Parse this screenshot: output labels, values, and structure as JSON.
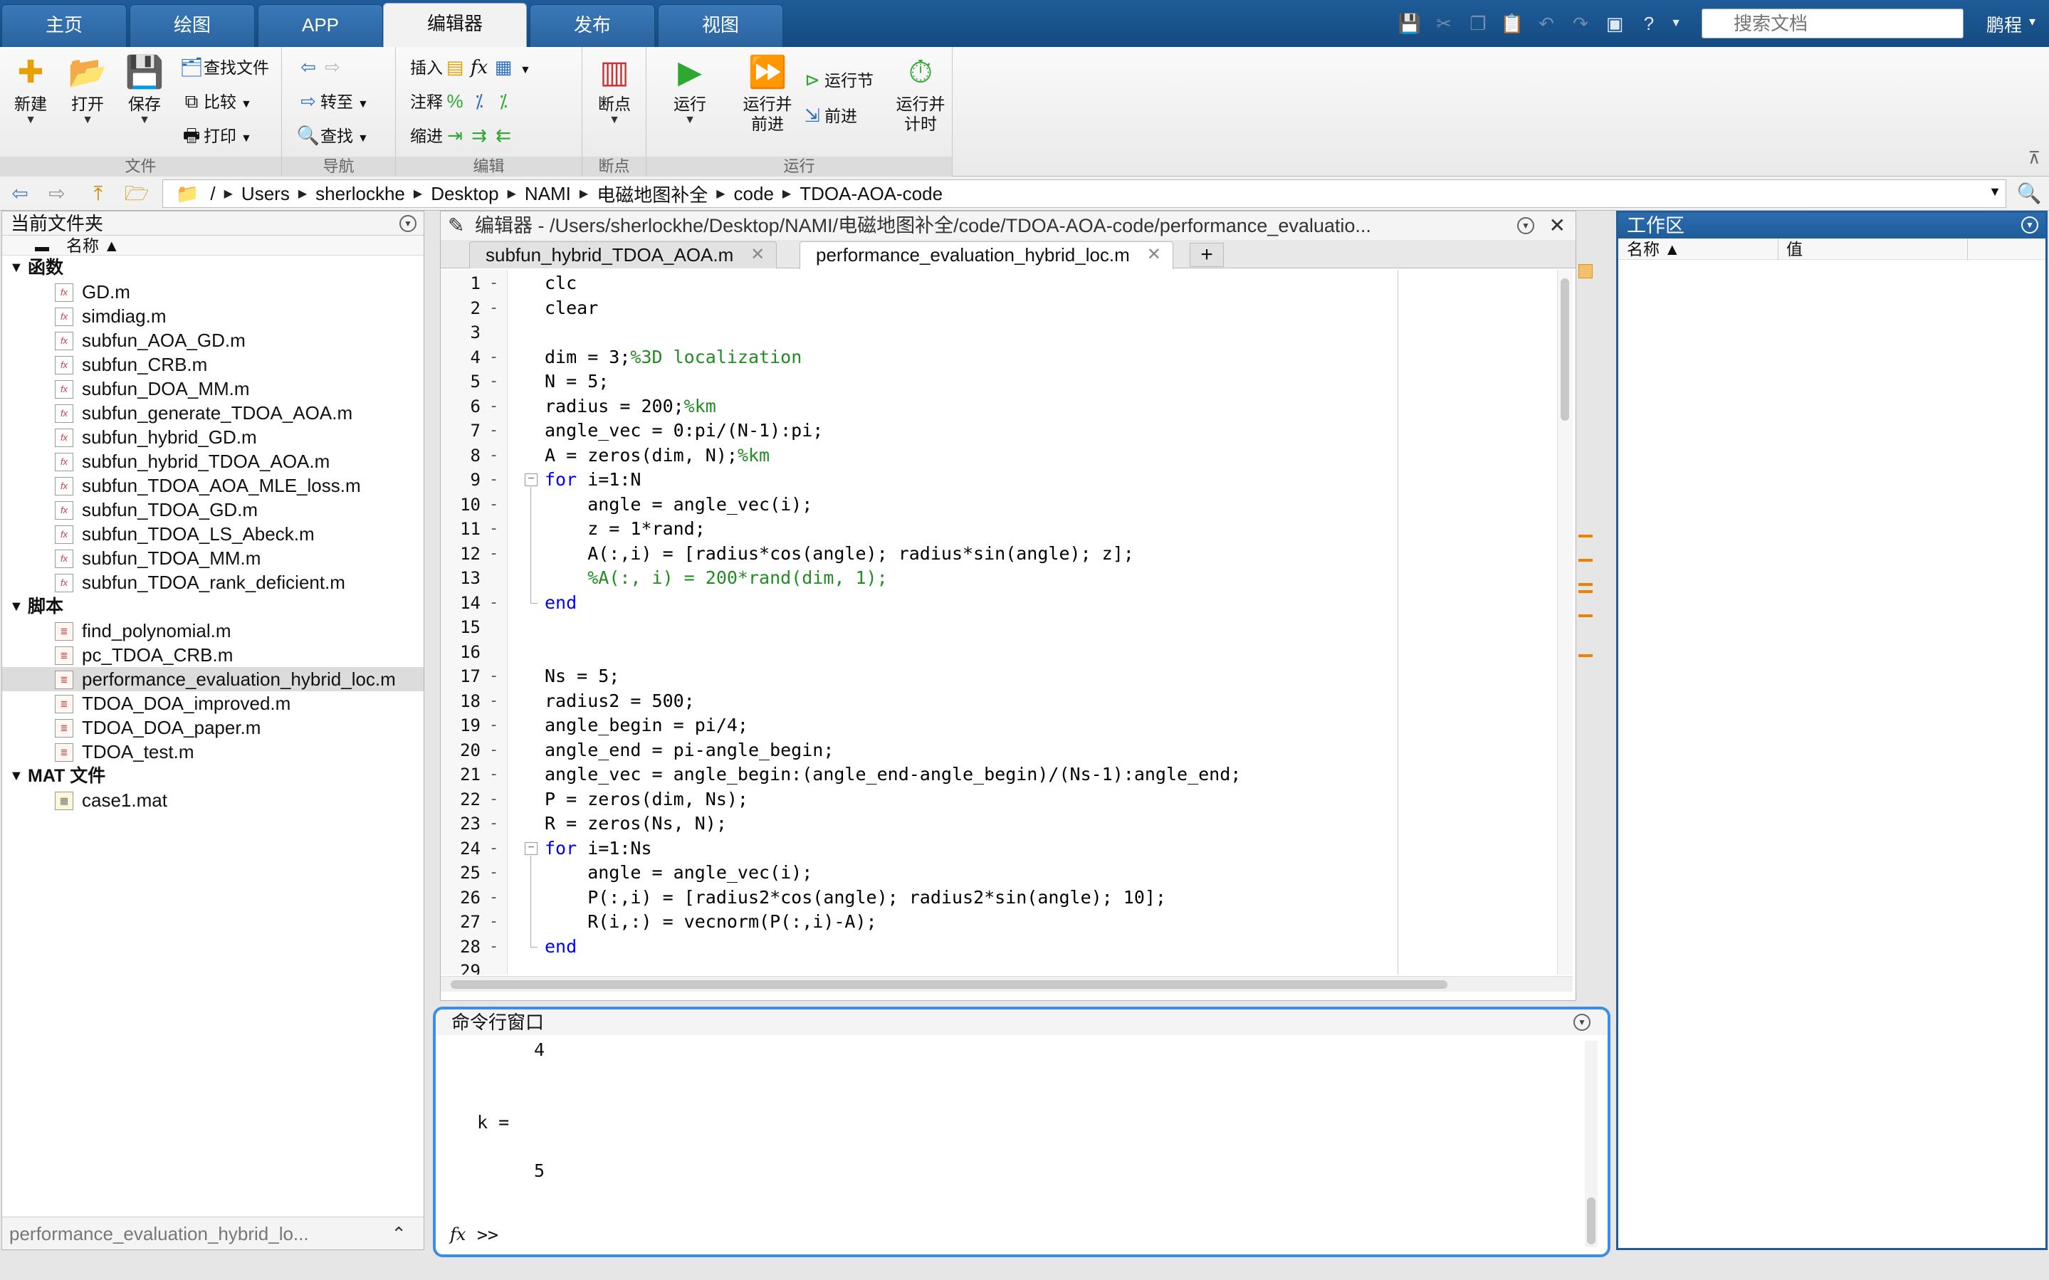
{
  "top_tabs": [
    {
      "label": "主页"
    },
    {
      "label": "绘图"
    },
    {
      "label": "APP"
    },
    {
      "label": "编辑器"
    },
    {
      "label": "发布"
    },
    {
      "label": "视图"
    }
  ],
  "search": {
    "placeholder": "搜索文档"
  },
  "user": {
    "name": "鹏程"
  },
  "ribbon": {
    "groups": {
      "file": "文件",
      "nav": "导航",
      "edit": "编辑",
      "breakpoints": "断点",
      "run": "运行"
    },
    "new": "新建",
    "open": "打开",
    "save": "保存",
    "find_files": "查找文件",
    "compare": "比较",
    "print": "打印",
    "goto": "转至",
    "find": "查找",
    "insert": "插入",
    "comment": "注释",
    "indent": "缩进",
    "breakpoint": "断点",
    "run_btn": "运行",
    "run_advance": "运行并\n前进",
    "run_section": "运行节",
    "advance": "前进",
    "run_time": "运行并\n计时",
    "fx": "fx",
    "percent": "%"
  },
  "path": [
    "Users",
    "sherlockhe",
    "Desktop",
    "NAMI",
    "电磁地图补全",
    "code",
    "TDOA-AOA-code"
  ],
  "path_root": "/",
  "folder": {
    "title": "当前文件夹",
    "col_name": "名称 ▲",
    "sections": [
      {
        "name": "函数",
        "files": [
          "GD.m",
          "simdiag.m",
          "subfun_AOA_GD.m",
          "subfun_CRB.m",
          "subfun_DOA_MM.m",
          "subfun_generate_TDOA_AOA.m",
          "subfun_hybrid_GD.m",
          "subfun_hybrid_TDOA_AOA.m",
          "subfun_TDOA_AOA_MLE_loss.m",
          "subfun_TDOA_GD.m",
          "subfun_TDOA_LS_Abeck.m",
          "subfun_TDOA_MM.m",
          "subfun_TDOA_rank_deficient.m"
        ]
      },
      {
        "name": "脚本",
        "files": [
          "find_polynomial.m",
          "pc_TDOA_CRB.m",
          "performance_evaluation_hybrid_loc.m",
          "TDOA_DOA_improved.m",
          "TDOA_DOA_paper.m",
          "TDOA_test.m"
        ]
      },
      {
        "name": "MAT 文件",
        "files": [
          "case1.mat"
        ]
      }
    ],
    "footer": "performance_evaluation_hybrid_lo..."
  },
  "editor": {
    "title": "编辑器 - /Users/sherlockhe/Desktop/NAMI/电磁地图补全/code/TDOA-AOA-code/performance_evaluatio...",
    "tabs": [
      {
        "label": "subfun_hybrid_TDOA_AOA.m"
      },
      {
        "label": "performance_evaluation_hybrid_loc.m"
      }
    ],
    "new_tab": "+",
    "lines": [
      {
        "n": "1",
        "t": "clc"
      },
      {
        "n": "2",
        "t": "clear"
      },
      {
        "n": "3",
        "t": ""
      },
      {
        "n": "4",
        "t": "dim = 3;",
        "c": "%3D localization"
      },
      {
        "n": "5",
        "t": "N = 5;"
      },
      {
        "n": "6",
        "t": "radius = 200;",
        "c": "%km"
      },
      {
        "n": "7",
        "t": "angle_vec = 0:pi/(N-1):pi;"
      },
      {
        "n": "8",
        "t": "A = zeros(dim, N);",
        "c": "%km"
      },
      {
        "n": "9",
        "k": "for",
        "t": " i=1:N"
      },
      {
        "n": "10",
        "t": "    angle = angle_vec(i);"
      },
      {
        "n": "11",
        "t": "    z = 1*rand;"
      },
      {
        "n": "12",
        "t": "    A(:,i) = [radius*cos(angle); radius*sin(angle); z];"
      },
      {
        "n": "13",
        "t": "    ",
        "c": "%A(:, i) = 200*rand(dim, 1);"
      },
      {
        "n": "14",
        "k": "end",
        "t": ""
      },
      {
        "n": "15",
        "t": ""
      },
      {
        "n": "16",
        "t": ""
      },
      {
        "n": "17",
        "t": "Ns = 5;"
      },
      {
        "n": "18",
        "t": "radius2 = 500;"
      },
      {
        "n": "19",
        "t": "angle_begin = pi/4;"
      },
      {
        "n": "20",
        "t": "angle_end = pi-angle_begin;"
      },
      {
        "n": "21",
        "t": "angle_vec = angle_begin:(angle_end-angle_begin)/(Ns-1):angle_end;"
      },
      {
        "n": "22",
        "t": "P = zeros(dim, Ns);"
      },
      {
        "n": "23",
        "t": "R = zeros(Ns, N);"
      },
      {
        "n": "24",
        "k": "for",
        "t": " i=1:Ns"
      },
      {
        "n": "25",
        "t": "    angle = angle_vec(i);"
      },
      {
        "n": "26",
        "t": "    P(:,i) = [radius2*cos(angle); radius2*sin(angle); 10];"
      },
      {
        "n": "27",
        "t": "    R(i,:) = vecnorm(P(:,i)-A);"
      },
      {
        "n": "28",
        "k": "end",
        "t": ""
      },
      {
        "n": "29",
        "t": ""
      }
    ]
  },
  "command": {
    "title": "命令行窗口",
    "lines": [
      "4",
      "k =",
      "5"
    ],
    "prompt": ">>",
    "fx": "fx"
  },
  "workspace": {
    "title": "工作区",
    "col_name": "名称 ▲",
    "col_value": "值"
  }
}
